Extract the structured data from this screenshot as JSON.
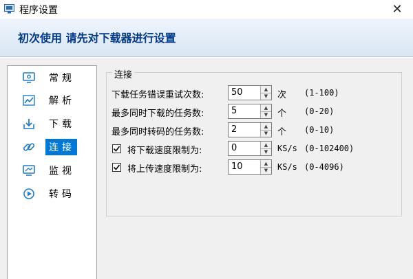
{
  "window": {
    "title": "程序设置",
    "close_glyph": "✕"
  },
  "banner": {
    "text": "初次使用 请先对下载器进行设置"
  },
  "sidebar": {
    "items": [
      {
        "label": "常规",
        "icon": "monitor-gear-icon",
        "active": false
      },
      {
        "label": "解析",
        "icon": "chart-icon",
        "active": false
      },
      {
        "label": "下载",
        "icon": "download-icon",
        "active": false
      },
      {
        "label": "连接",
        "icon": "link-icon",
        "active": true
      },
      {
        "label": "监视",
        "icon": "monitor-icon",
        "active": false
      },
      {
        "label": "转码",
        "icon": "convert-icon",
        "active": false
      }
    ]
  },
  "group": {
    "title": "连接",
    "rows": [
      {
        "label": "下载任务错误重试次数:",
        "value": "50",
        "unit": "次",
        "range": "(1-100)",
        "has_checkbox": false
      },
      {
        "label": "最多同时下载的任务数:",
        "value": "5",
        "unit": "个",
        "range": "(0-20)",
        "has_checkbox": false
      },
      {
        "label": "最多同时转码的任务数:",
        "value": "2",
        "unit": "个",
        "range": "(0-10)",
        "has_checkbox": false
      },
      {
        "label": "将下载速度限制为:",
        "value": "0",
        "unit": "KS/s",
        "range": "(0-102400)",
        "has_checkbox": true,
        "checked": true
      },
      {
        "label": "将上传速度限制为:",
        "value": "10",
        "unit": "KS/s",
        "range": "(0-4096)",
        "has_checkbox": true,
        "checked": true
      }
    ]
  },
  "colors": {
    "accent": "#0078d7",
    "banner_text": "#003a8c",
    "icon_blue": "#1e7bd6"
  }
}
